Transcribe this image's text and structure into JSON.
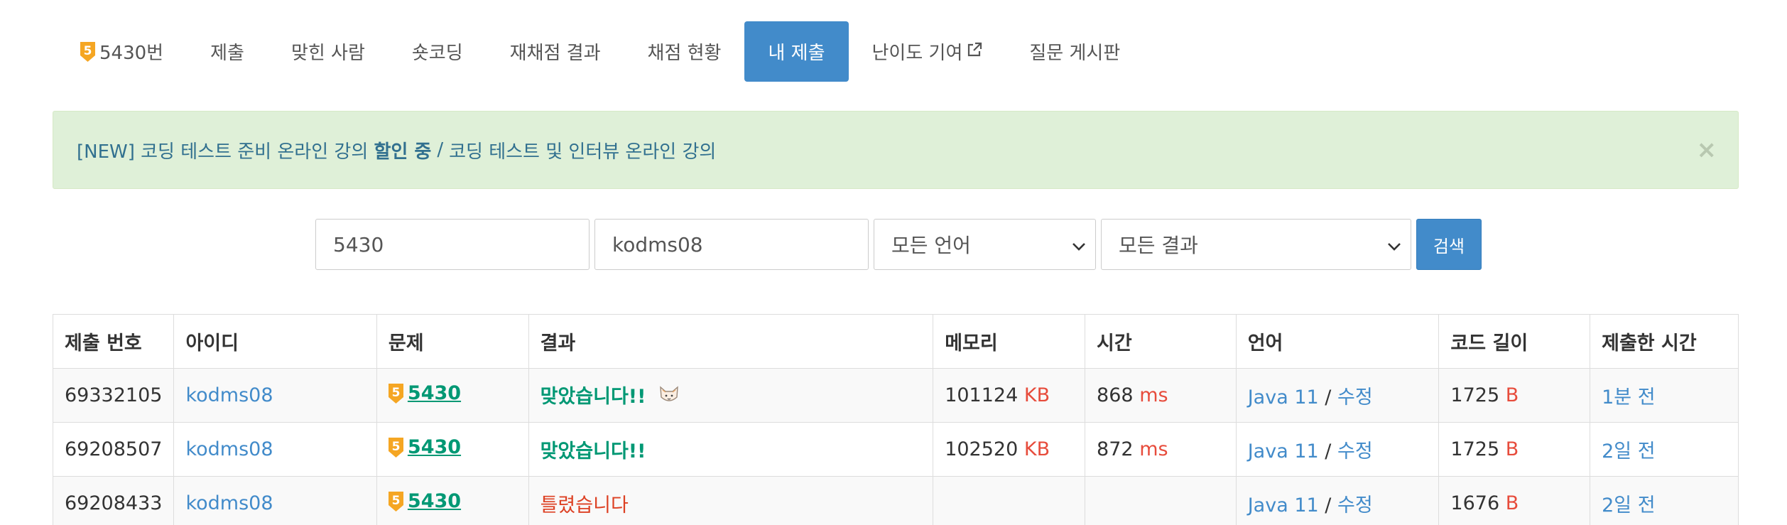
{
  "colors": {
    "primary": "#428bca",
    "accepted": "#009874",
    "wrong": "#dd4124",
    "unit": "#e74c3c",
    "tier_silver": "#f5a623",
    "alert_bg": "#dff0d8"
  },
  "nav": {
    "items": [
      {
        "label": "5430번",
        "icon": "tier-shield-icon",
        "tier": "5"
      },
      {
        "label": "제출"
      },
      {
        "label": "맞힌 사람"
      },
      {
        "label": "숏코딩"
      },
      {
        "label": "재채점 결과"
      },
      {
        "label": "채점 현황"
      },
      {
        "label": "내 제출",
        "active": true
      },
      {
        "label": "난이도 기여",
        "icon": "external-link-icon"
      },
      {
        "label": "질문 게시판"
      }
    ]
  },
  "alert": {
    "prefix": "[NEW] 코딩 테스트 준비 온라인 강의 ",
    "highlight": "할인 중",
    "separator": "/",
    "second": "코딩 테스트 및 인터뷰 온라인 강의",
    "close": "×"
  },
  "search": {
    "problem_id": "5430",
    "user_id": "kodms08",
    "language": "모든 언어",
    "result": "모든 결과",
    "button": "검색"
  },
  "table": {
    "headers": [
      "제출 번호",
      "아이디",
      "문제",
      "결과",
      "메모리",
      "시간",
      "언어",
      "코드 길이",
      "제출한 시간"
    ],
    "rows": [
      {
        "submission_id": "69332105",
        "user": "kodms08",
        "tier": "5",
        "problem": "5430",
        "result": "맞았습니다!!",
        "result_type": "accepted",
        "fox": true,
        "memory": "101124",
        "memory_unit": "KB",
        "time": "868",
        "time_unit": "ms",
        "language": "Java 11",
        "lang_sep": "/",
        "edit": "수정",
        "code_length": "1725",
        "code_unit": "B",
        "submitted": "1분 전"
      },
      {
        "submission_id": "69208507",
        "user": "kodms08",
        "tier": "5",
        "problem": "5430",
        "result": "맞았습니다!!",
        "result_type": "accepted",
        "fox": false,
        "memory": "102520",
        "memory_unit": "KB",
        "time": "872",
        "time_unit": "ms",
        "language": "Java 11",
        "lang_sep": "/",
        "edit": "수정",
        "code_length": "1725",
        "code_unit": "B",
        "submitted": "2일 전"
      },
      {
        "submission_id": "69208433",
        "user": "kodms08",
        "tier": "5",
        "problem": "5430",
        "result": "틀렸습니다",
        "result_type": "wrong",
        "fox": false,
        "memory": "",
        "memory_unit": "",
        "time": "",
        "time_unit": "",
        "language": "Java 11",
        "lang_sep": "/",
        "edit": "수정",
        "code_length": "1676",
        "code_unit": "B",
        "submitted": "2일 전"
      }
    ]
  }
}
